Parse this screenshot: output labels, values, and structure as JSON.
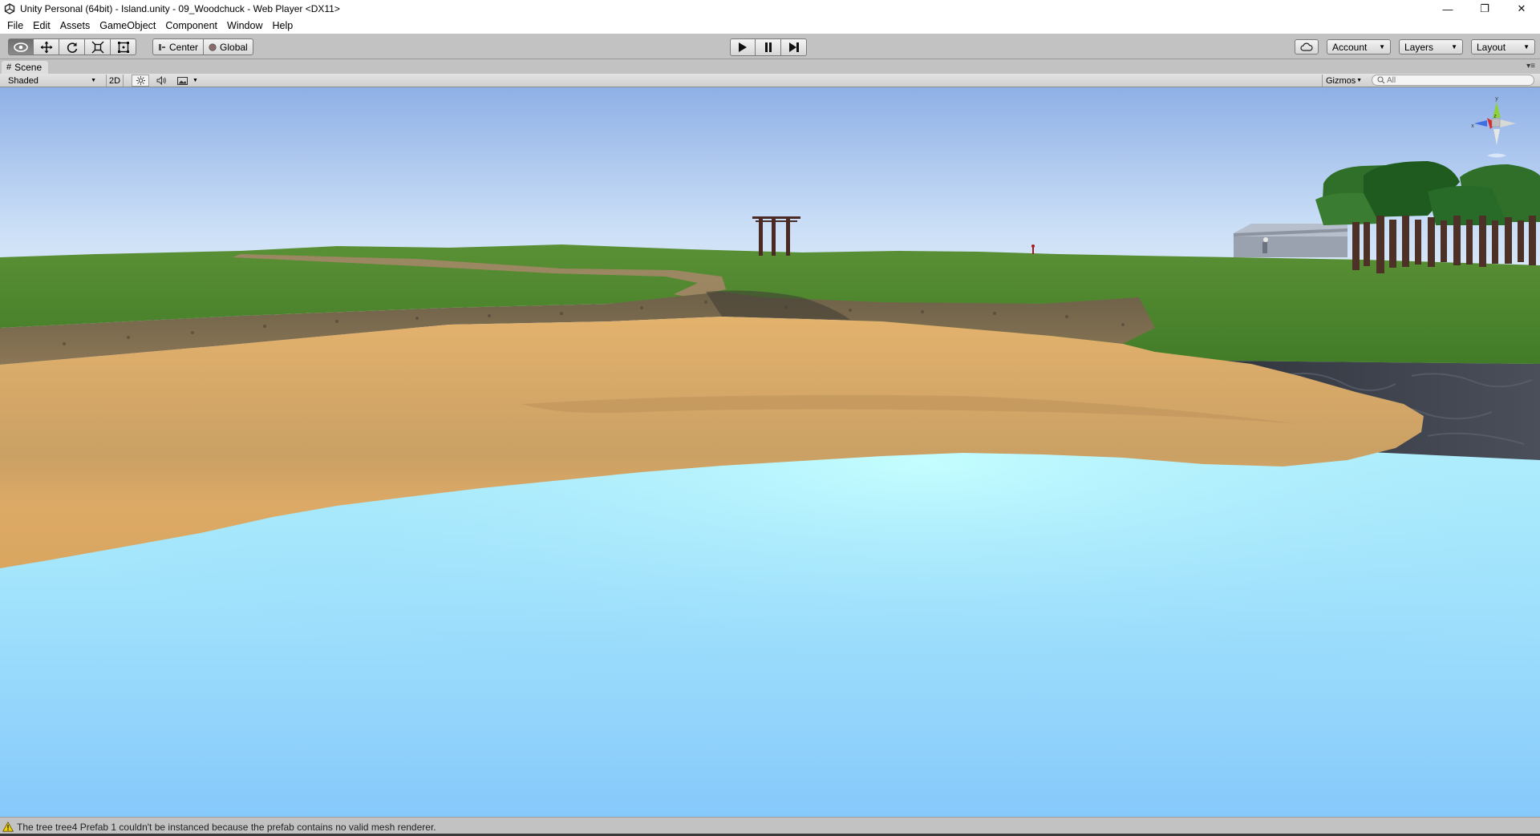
{
  "window": {
    "title": "Unity Personal (64bit) - Island.unity - 09_Woodchuck - Web Player <DX11>",
    "controls": [
      "—",
      "❐",
      "✕"
    ]
  },
  "menu": [
    "File",
    "Edit",
    "Assets",
    "GameObject",
    "Component",
    "Window",
    "Help"
  ],
  "toolbar": {
    "transform_tools": [
      "hand-eye-icon",
      "move-icon",
      "rotate-icon",
      "scale-icon",
      "rect-icon"
    ],
    "active_tool": "hand-eye-icon",
    "pivot_mode": "Center",
    "pivot_rotation": "Global",
    "play_controls": [
      "play-icon",
      "pause-icon",
      "step-icon"
    ],
    "account_label": "Account",
    "layers_label": "Layers",
    "layout_label": "Layout"
  },
  "scene": {
    "tab_label": "Scene",
    "draw_mode": "Shaded",
    "mode_2d": "2D",
    "gizmos_label": "Gizmos",
    "search_placeholder": "All",
    "gizmo_axes": [
      "y",
      "x",
      "z"
    ]
  },
  "status": {
    "message": "The tree tree4 Prefab 1 couldn't be instanced because the prefab contains no valid mesh renderer."
  },
  "colors": {
    "sky_top": "#8fb0e6",
    "sky_horizon": "#eef6fb",
    "grass": "#4f8a2a",
    "sand": "#d9ab66",
    "water": "#a7e8fb",
    "rock": "#3a3f4a",
    "warning": "#e8c000"
  }
}
